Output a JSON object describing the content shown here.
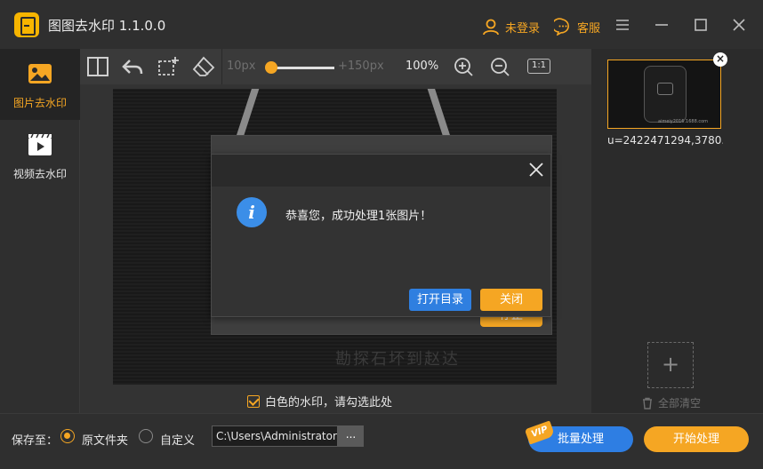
{
  "app": {
    "title": "图图去水印  1.1.0.0"
  },
  "header": {
    "login_label": "未登录",
    "service_label": "客服"
  },
  "icons": {
    "app": "app-logo-icon",
    "user": "user-icon",
    "service": "chat-icon",
    "menu": "menu-icon",
    "minimize": "minimize-icon",
    "maximize": "maximize-icon",
    "close": "close-icon",
    "image_mode": "image-icon",
    "video_mode": "video-icon",
    "compare": "split-view-icon",
    "undo": "undo-icon",
    "select": "rect-select-icon",
    "eraser": "eraser-icon",
    "zoom_in": "zoom-in-icon",
    "zoom_out": "zoom-out-icon",
    "info": "info-icon",
    "trash": "trash-icon",
    "add": "plus-icon"
  },
  "sidebar": {
    "items": [
      {
        "label": "图片去水印",
        "active": true
      },
      {
        "label": "视频去水印",
        "active": false
      }
    ]
  },
  "toolbar": {
    "brush_min": "10px",
    "brush_max": "+150px",
    "brush_fraction": 0.0,
    "zoom": "100%",
    "ratio_label": "1:1"
  },
  "canvas": {
    "watermark_text": "勘探石坏到赵达",
    "white_watermark_label": "白色的水印，请勾选此处",
    "white_watermark_checked": true
  },
  "background_dialog": {
    "stop_label": "停止"
  },
  "dialog": {
    "message": "恭喜您，成功处理1张图片！",
    "open_dir_label": "打开目录",
    "close_label": "关闭"
  },
  "file_list": {
    "items": [
      {
        "name": "u=2422471294,3780...",
        "thumb_watermark": "aimeiy2016.1688.com"
      }
    ],
    "remove_label": "×",
    "add_label": "+",
    "clear_label": "全部清空"
  },
  "bottom": {
    "save_to_label": "保存至：",
    "option_original": "原文件夹",
    "option_custom": "自定义",
    "selected_option": "原文件夹",
    "path_value": "C:\\Users\\Administrator",
    "browse_label": "...",
    "vip_label": "VIP",
    "batch_label": "批量处理",
    "start_label": "开始处理"
  },
  "colors": {
    "accent": "#f5a623",
    "primary": "#2f7fe0",
    "background": "#2b2b2b"
  }
}
